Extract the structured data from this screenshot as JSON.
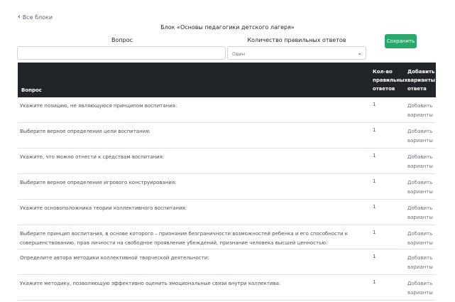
{
  "back_link": {
    "label": "Все блоки"
  },
  "title": "Блок «Основы педагогики детского лагеря»",
  "form": {
    "question_label": "Вопрос",
    "question_value": "",
    "count_label": "Количество правильных ответов",
    "count_selected": "Один"
  },
  "save_button": "Сохранить",
  "table": {
    "headers": {
      "question": "Вопрос",
      "count": [
        "Кол-во",
        "правильных",
        "ответов"
      ],
      "add": [
        "Добавить",
        "варианты",
        "ответа"
      ]
    },
    "add_label": [
      "Добавить",
      "варианты"
    ],
    "rows": [
      {
        "question": "Укажите позицию, не являющуюся принципом воспитания:",
        "count": "1"
      },
      {
        "question": "Выберите верное определение цели воспитания:",
        "count": "1"
      },
      {
        "question": "Укажите, что можно отнести к средствам воспитания:",
        "count": "1"
      },
      {
        "question": "Выберите верное определение игрового конструирования:",
        "count": "1"
      },
      {
        "question": "Укажите основоположника теории коллективного воспитания:",
        "count": "1"
      },
      {
        "question": "Выберите принцип воспитания, в основе которого – признание безграничности возможностей ребенка и его способности к совершенствованию, прав личности на свободное проявление убеждений, признание человека высшей ценностью:",
        "count": "1"
      },
      {
        "question": "Определите автора методики коллективной творческой деятельности:",
        "count": "1"
      },
      {
        "question": "Укажите методику, позволяющую эффективно оценить эмоциональные связи внутри коллектива:",
        "count": "1"
      }
    ]
  }
}
